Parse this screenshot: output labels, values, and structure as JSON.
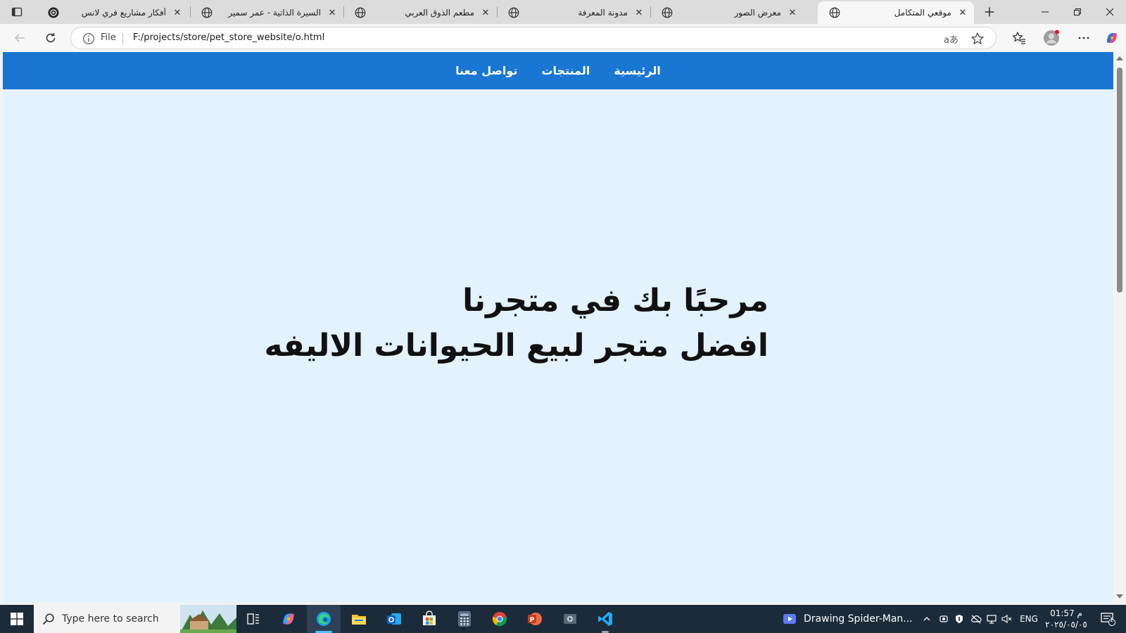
{
  "browser": {
    "tabs": [
      {
        "title": "أفكار مشاريع فري لانس",
        "icon": "openai-icon",
        "active": false
      },
      {
        "title": "السيرة الذاتية - عمر سمير",
        "icon": "globe-icon",
        "active": false
      },
      {
        "title": "مطعم الذوق العربي",
        "icon": "globe-icon",
        "active": false
      },
      {
        "title": "مدونة المعرفة",
        "icon": "globe-icon",
        "active": false
      },
      {
        "title": "معرض الصور",
        "icon": "globe-icon",
        "active": false
      },
      {
        "title": "موقعي المتكامل",
        "icon": "globe-icon",
        "active": true
      }
    ],
    "address": {
      "scheme_label": "File",
      "url": "F:/projects/store/pet_store_website/o.html",
      "read_aloud": "aあ"
    }
  },
  "page": {
    "nav": {
      "home": "الرئيسية",
      "products": "المنتجات",
      "contact": "تواصل معنا"
    },
    "hero": {
      "line1": "مرحبًا بك في متجرنا",
      "line2": "افضل متجر لبيع الحيوانات الاليفه"
    },
    "colors": {
      "nav_bg": "#1976d2",
      "page_bg": "#e3f2fd"
    }
  },
  "taskbar": {
    "search_placeholder": "Type here to search",
    "media_title": "Drawing Spider-Man...",
    "language": "ENG",
    "time": "01:57 م",
    "date": "٢٠٢٥/٠٥/٠٥",
    "notification_count": "1"
  }
}
